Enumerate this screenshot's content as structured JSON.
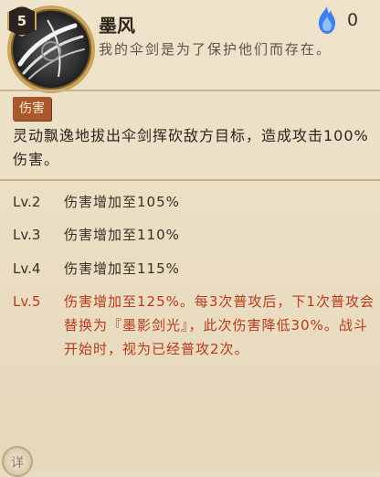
{
  "skill": {
    "level": "5",
    "name": "墨风",
    "quote": "我的伞剑是为了保护他们而存在。",
    "cost": "0"
  },
  "tag": "伤害",
  "description": "灵动飘逸地拔出伞剑挥砍敌方目标，造成攻击100%伤害。",
  "levels": [
    {
      "label": "Lv.2",
      "text": "伤害增加至105%"
    },
    {
      "label": "Lv.3",
      "text": "伤害增加至110%"
    },
    {
      "label": "Lv.4",
      "text": "伤害增加至115%"
    },
    {
      "label": "Lv.5",
      "text": "伤害增加至125%。每3次普攻后，下1次普攻会替换为『墨影剑光』，此次伤害降低30%。战斗开始时，视为已经普攻2次。"
    }
  ],
  "detail_button": "详",
  "colors": {
    "max_level_text": "#b83a1c",
    "tag_bg": "#a9582c",
    "fire": "#3f7ff0"
  },
  "icons": [
    "skill-ink-wind-icon",
    "blue-flame-icon"
  ]
}
